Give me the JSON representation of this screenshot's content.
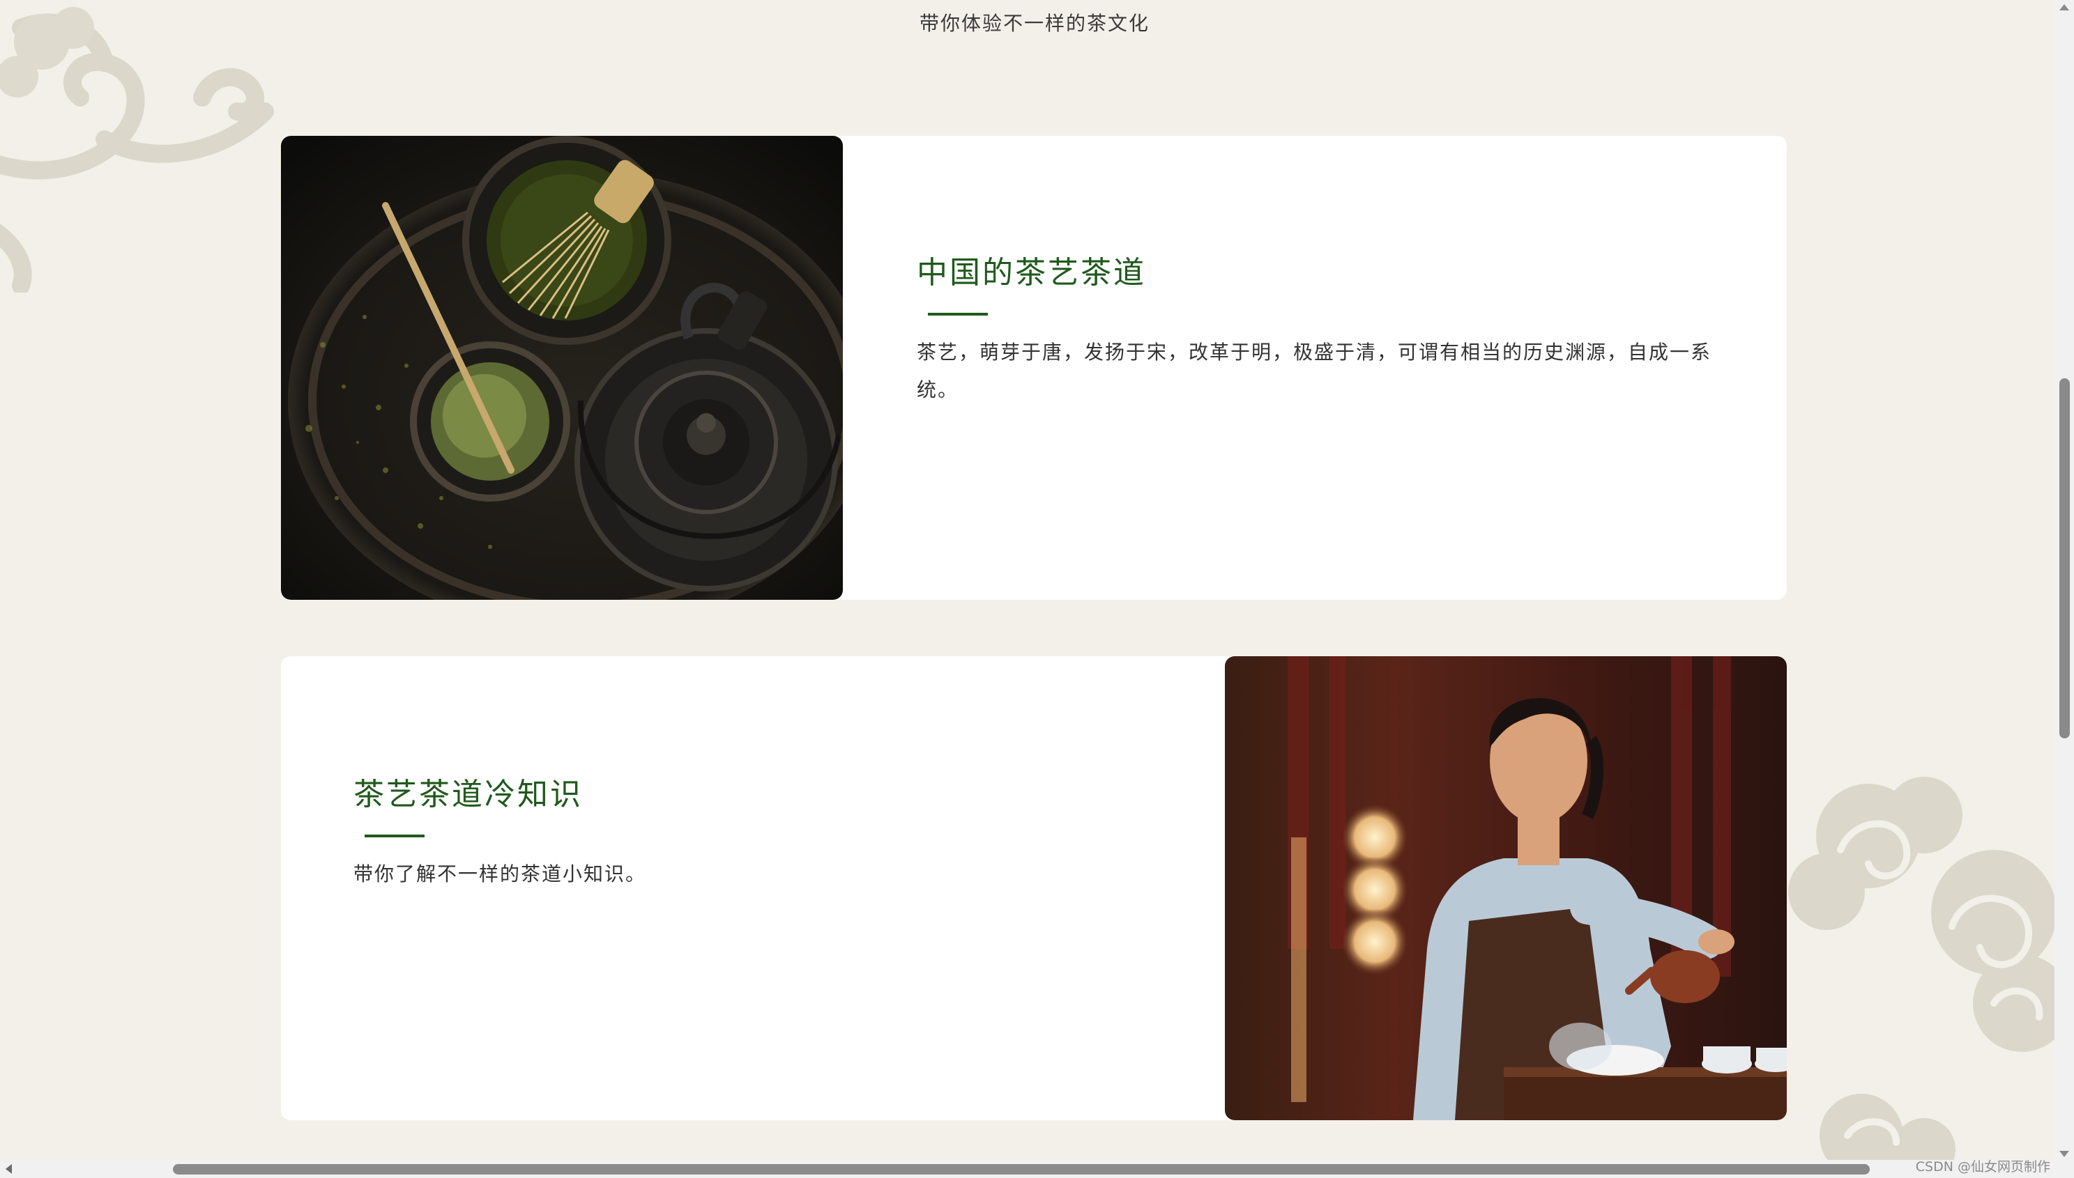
{
  "header": {
    "subtitle": "带你体验不一样的茶文化"
  },
  "sections": [
    {
      "title": "中国的茶艺茶道",
      "description": "茶艺，萌芽于唐，发扬于宋，改革于明，极盛于清，可谓有相当的历史渊源，自成一系统。",
      "image": "matcha-tea-set-photo"
    },
    {
      "title": "茶艺茶道冷知识",
      "description": "带你了解不一样的茶道小知识。",
      "image": "woman-pouring-tea-photo"
    }
  ],
  "colors": {
    "background": "#f2f0e9",
    "accent": "#1f5a1c",
    "card": "#ffffff",
    "text": "#333333"
  },
  "decorations": {
    "top_left": "cloud-ornament-icon",
    "bottom_right": "cloud-ornament-icon"
  },
  "watermark": "CSDN @仙女网页制作"
}
